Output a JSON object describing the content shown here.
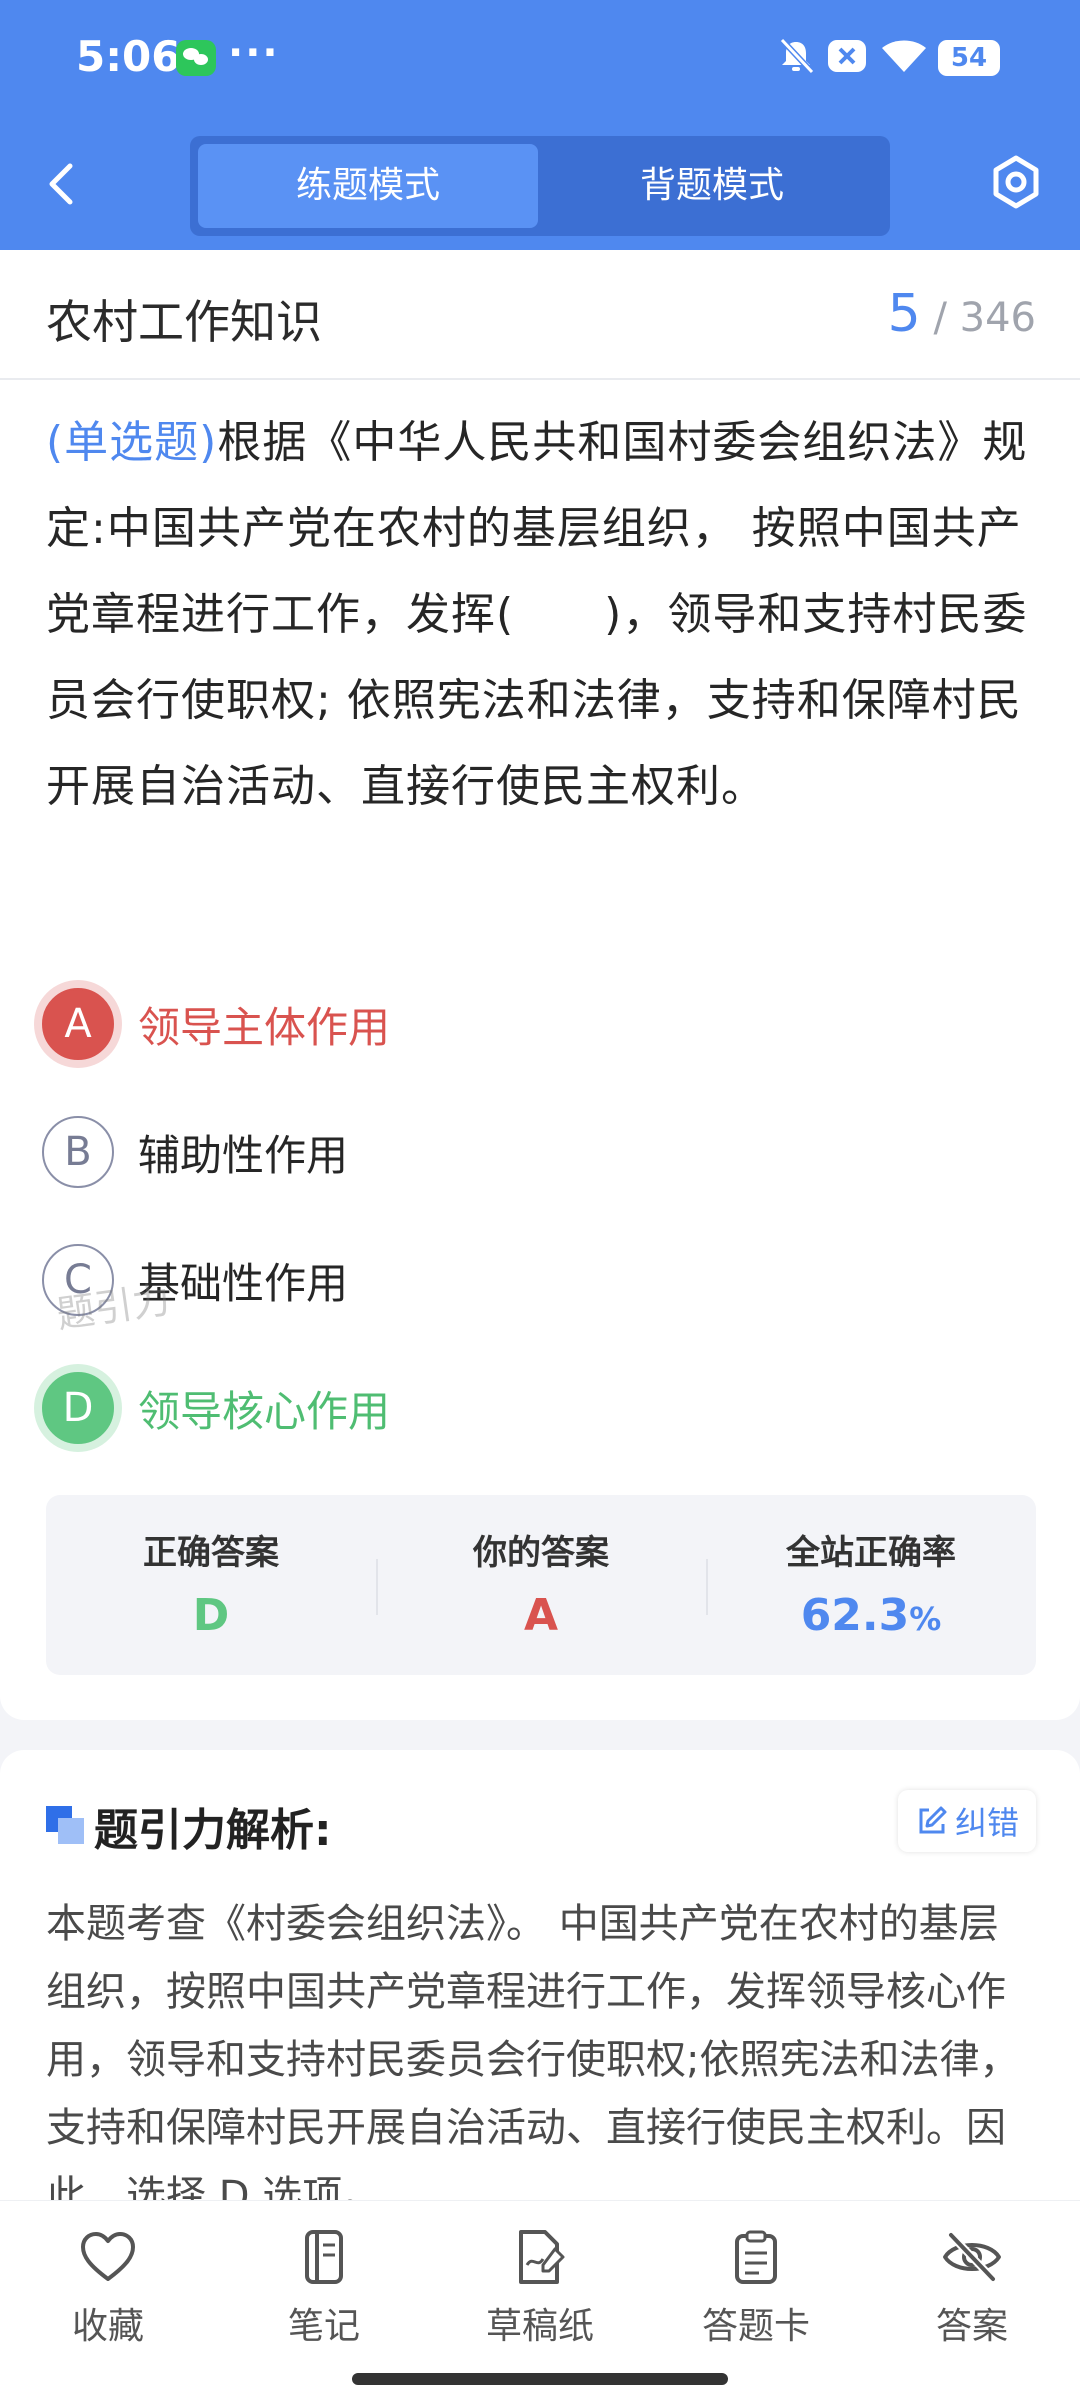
{
  "status_bar": {
    "time": "5:06",
    "more": "···",
    "battery": "54"
  },
  "nav": {
    "tabs": [
      {
        "label": "练题模式",
        "active": true
      },
      {
        "label": "背题模式",
        "active": false
      }
    ]
  },
  "question": {
    "category": "农村工作知识",
    "current": "5",
    "total": "346",
    "type_label": "(单选题)",
    "text": "根据《中华人民共和国村委会组织法》规定:中国共产党在农村的基层组织， 按照中国共产党章程进行工作，发挥(　　)，领导和支持村民委员会行使职权; 依照宪法和法律，支持和保障村民开展自治活动、直接行使民主权利。",
    "watermark": "题引力",
    "options": [
      {
        "letter": "A",
        "text": "领导主体作用",
        "state": "wrong"
      },
      {
        "letter": "B",
        "text": "辅助性作用",
        "state": "normal"
      },
      {
        "letter": "C",
        "text": "基础性作用",
        "state": "normal"
      },
      {
        "letter": "D",
        "text": "领导核心作用",
        "state": "correct"
      }
    ]
  },
  "summary": {
    "correct_label": "正确答案",
    "correct_value": "D",
    "yours_label": "你的答案",
    "yours_value": "A",
    "rate_label": "全站正确率",
    "rate_value": "62.3",
    "rate_unit": "%"
  },
  "analysis": {
    "title": "题引力解析:",
    "report_label": "纠错",
    "text": "本题考查《村委会组织法》。 中国共产党在农村的基层组织，按照中国共产党章程进行工作，发挥领导核心作用，领导和支持村民委员会行使职权;依照宪法和法律，支持和保障村民开展自治活动、直接行使民主权利。因此，选择 D 选项。"
  },
  "bottom_bar": {
    "items": [
      {
        "label": "收藏",
        "icon": "heart-icon"
      },
      {
        "label": "笔记",
        "icon": "notebook-icon"
      },
      {
        "label": "草稿纸",
        "icon": "draft-paper-icon"
      },
      {
        "label": "答题卡",
        "icon": "answer-sheet-icon"
      },
      {
        "label": "答案",
        "icon": "eye-off-icon"
      }
    ]
  },
  "colors": {
    "primary": "#4f88ef",
    "wrong": "#d9534f",
    "correct": "#5fc782"
  }
}
